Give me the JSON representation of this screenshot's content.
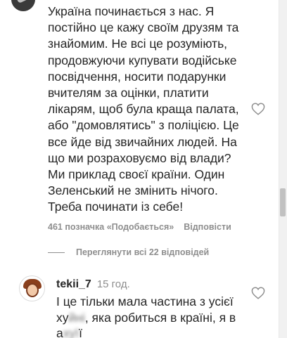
{
  "comment": {
    "text": "Україна починається з нас. Я\nпостійно це кажу своїм друзям та\nзнайомим. Не всі це розуміють,\nпродовжуючи купувати водійське\nпосвідчення, носити подарунки\nвчителям за оцінки, платити\nлікарям, щоб була краща палата,\nабо \"домовлятись\" з поліцією. Це\nвсе йде від звичайних людей. На\nщо ми розраховуємо від влади?\nМи приклад своєї країни. Один\nЗеленський не змінить нічого.\nТреба починати із себе!",
    "likes": "461 позначка «Подобається»",
    "reply_label": "Відповісти"
  },
  "view_replies": "Переглянути всі 22 відповідей",
  "reply": {
    "username": "tekii_7",
    "time": "15 год.",
    "text_line1": "І це тільки мала частина з усієї",
    "text_line2_pre": "ху",
    "text_line2_blur": "йні",
    "text_line2_post": ", яка робиться в країні, я в",
    "text_line3_pre": "а",
    "text_line3_blur": "хуї",
    "text_line3_post": "ї"
  },
  "icons": {
    "like": "heart-outline-icon"
  }
}
